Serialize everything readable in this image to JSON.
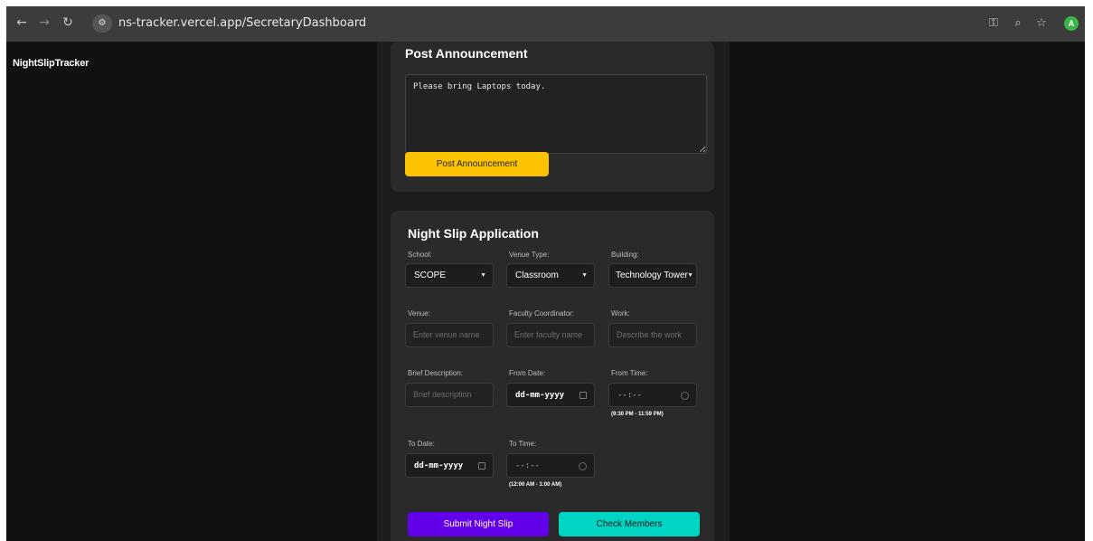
{
  "browser": {
    "back_icon": "arrow-left-icon",
    "forward_icon": "arrow-right-icon",
    "reload_icon": "reload-icon",
    "url": "ns-tracker.vercel.app/SecretaryDashboard",
    "avatar_letter": "A"
  },
  "app": {
    "title": "NightSlipTracker"
  },
  "announcement": {
    "title": "Post Announcement",
    "text": "Please bring Laptops today.",
    "button_label": "Post Announcement"
  },
  "night_slip": {
    "title": "Night Slip Application",
    "school": {
      "label": "School:",
      "value": "SCOPE"
    },
    "venue_type": {
      "label": "Venue Type:",
      "value": "Classroom"
    },
    "building": {
      "label": "Building:",
      "value": "Technology Tower"
    },
    "venue": {
      "label": "Venue:",
      "placeholder": "Enter venue name"
    },
    "faculty": {
      "label": "Faculty Coordinator:",
      "placeholder": "Enter faculty name"
    },
    "work": {
      "label": "Work:",
      "placeholder": "Describe the work"
    },
    "brief": {
      "label": "Brief Description:",
      "placeholder": "Brief description"
    },
    "from_date": {
      "label": "From Date:",
      "placeholder": "dd-mm-yyyy"
    },
    "from_time": {
      "label": "From Time:",
      "placeholder": "--:--",
      "hint": "(9:30 PM - 11:59 PM)"
    },
    "to_date": {
      "label": "To Date:",
      "placeholder": "dd-mm-yyyy"
    },
    "to_time": {
      "label": "To Time:",
      "placeholder": "--:--",
      "hint": "(12:00 AM - 1:00 AM)"
    },
    "submit_label": "Submit Night Slip",
    "check_label": "Check Members"
  },
  "colors": {
    "yellow": "#fcc300",
    "purple": "#6200ea",
    "teal": "#00d4c2"
  }
}
